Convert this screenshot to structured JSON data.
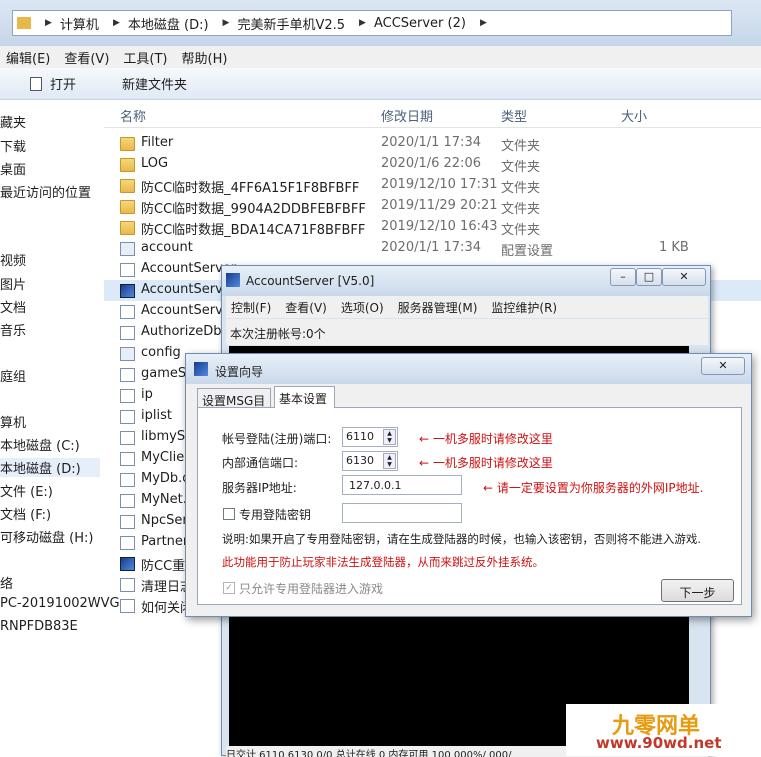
{
  "explorer": {
    "breadcrumb": [
      "计算机",
      "本地磁盘 (D:)",
      "完美新手单机V2.5",
      "ACCServer (2)"
    ],
    "menu": [
      "编辑(E)",
      "查看(V)",
      "工具(T)",
      "帮助(H)"
    ],
    "toolbar": {
      "open": "打开",
      "new_folder": "新建文件夹"
    },
    "nav": [
      "藏夹",
      "下载",
      "桌面",
      "最近访问的位置",
      "视频",
      "图片",
      "文档",
      "音乐",
      "庭组",
      "算机",
      "本地磁盘 (C:)",
      "本地磁盘 (D:)",
      "文件 (E:)",
      "文档 (F:)",
      "可移动磁盘 (H:)",
      "络",
      "PC-20191002WVG",
      "RNPFDB83E"
    ],
    "columns": {
      "name": "名称",
      "date": "修改日期",
      "type": "类型",
      "size": "大小"
    },
    "files": [
      {
        "name": "Filter",
        "date": "2020/1/1 17:34",
        "type": "文件夹",
        "size": "",
        "icon": "folder"
      },
      {
        "name": "LOG",
        "date": "2020/1/6 22:06",
        "type": "文件夹",
        "size": "",
        "icon": "folder"
      },
      {
        "name": "防CC临时数据_4FF6A15F1F8BFBFF",
        "date": "2019/12/10 17:31",
        "type": "文件夹",
        "size": "",
        "icon": "folder"
      },
      {
        "name": "防CC临时数据_9904A2DDBFEBFBFF",
        "date": "2019/11/29 20:21",
        "type": "文件夹",
        "size": "",
        "icon": "folder"
      },
      {
        "name": "防CC临时数据_BDA14CA71F8BFBFF",
        "date": "2019/12/10 16:43",
        "type": "文件夹",
        "size": "",
        "icon": "folder"
      },
      {
        "name": "account",
        "date": "2020/1/1 17:34",
        "type": "配置设置",
        "size": "1 KB",
        "icon": "cfg"
      },
      {
        "name": "AccountServer",
        "date": "",
        "type": "",
        "size": "",
        "icon": "doc"
      },
      {
        "name": "AccountServer",
        "date": "",
        "type": "",
        "size": "",
        "icon": "exe"
      },
      {
        "name": "AccountServer",
        "date": "",
        "type": "",
        "size": "",
        "icon": "doc"
      },
      {
        "name": "AuthorizeDb.",
        "date": "",
        "type": "",
        "size": "",
        "icon": "doc"
      },
      {
        "name": "config",
        "date": "",
        "type": "",
        "size": "",
        "icon": "cfg"
      },
      {
        "name": "gameSe",
        "date": "",
        "type": "",
        "size": "",
        "icon": "doc"
      },
      {
        "name": "ip",
        "date": "",
        "type": "",
        "size": "",
        "icon": "doc"
      },
      {
        "name": "iplist",
        "date": "",
        "type": "",
        "size": "",
        "icon": "doc"
      },
      {
        "name": "libmySQ",
        "date": "",
        "type": "",
        "size": "",
        "icon": "doc"
      },
      {
        "name": "MyClien",
        "date": "",
        "type": "",
        "size": "",
        "icon": "doc"
      },
      {
        "name": "MyDb.d",
        "date": "",
        "type": "",
        "size": "",
        "icon": "doc"
      },
      {
        "name": "MyNet.c",
        "date": "",
        "type": "",
        "size": "",
        "icon": "doc"
      },
      {
        "name": "NpcSer",
        "date": "",
        "type": "",
        "size": "",
        "icon": "doc"
      },
      {
        "name": "Partner",
        "date": "",
        "type": "",
        "size": "",
        "icon": "doc"
      },
      {
        "name": "防CC重",
        "date": "",
        "type": "",
        "size": "",
        "icon": "exe"
      },
      {
        "name": "清理日志",
        "date": "",
        "type": "",
        "size": "",
        "icon": "doc"
      },
      {
        "name": "如何关闭",
        "date": "",
        "type": "",
        "size": "",
        "icon": "doc"
      }
    ]
  },
  "acc_window": {
    "title": "AccountServer [V5.0]",
    "menu": [
      "控制(F)",
      "查看(V)",
      "选项(O)",
      "服务器管理(M)",
      "监控维护(R)"
    ],
    "status": "本次注册帐号:0个",
    "statusbar": "日交计  6110  6130    0/0    总计在线      0       内存可用 100 000%/ 000/"
  },
  "wizard": {
    "title": "设置向导",
    "tabs": [
      "设置MSG目录",
      "基本设置"
    ],
    "account_port_label": "帐号登陆(注册)端口:",
    "account_port": "6110",
    "internal_port_label": "内部通信端口:",
    "internal_port": "6130",
    "server_ip_label": "服务器IP地址:",
    "server_ip": "127.0.0.1",
    "hint1": "← 一机多服时请修改这里",
    "hint2": "← 一机多服时请修改这里",
    "hint3": "← 请一定要设置为你服务器的外网IP地址.",
    "dedicated_key_label": "专用登陆密钥",
    "desc1": "说明:如果开启了专用登陆密钥，请在生成登陆器的时候，也输入该密钥，否则将不能进入游戏.",
    "desc2": "此功能用于防止玩家非法生成登陆器，从而来跳过反外挂系统。",
    "allow_only_label": "只允许专用登陆器进入游戏",
    "next_button": "下一步"
  },
  "watermark": {
    "line1": "九零网单",
    "line2": "www.90wd.net"
  },
  "colors": {
    "accent_red": "#d01010",
    "title_bar": "#c9d8ea",
    "folder": "#e8b94a"
  }
}
